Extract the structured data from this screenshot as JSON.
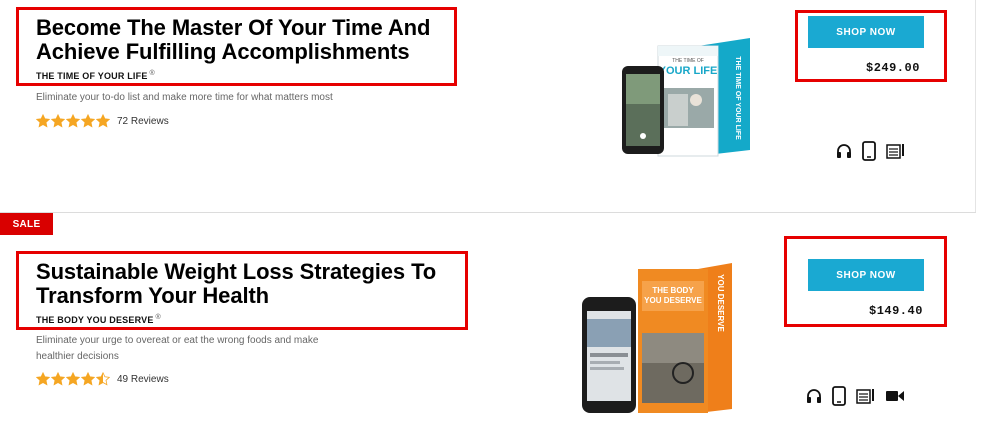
{
  "products": [
    {
      "title": "Become The Master Of Your Time And Achieve Fulfilling Accomplishments",
      "subtitle": "THE TIME OF YOUR LIFE",
      "trademark": "®",
      "description": "Eliminate your to-do list and make more time for what matters most",
      "rating": 5,
      "reviews": "72 Reviews",
      "shop_label": "SHOP NOW",
      "price": "$249.00",
      "box_top_text": "THE TIME OF",
      "box_main_text": "YOUR LIFE",
      "box_side_text": "THE TIME OF YOUR LIFE",
      "formats": [
        "headphones-icon",
        "mobile-icon",
        "workbook-icon"
      ]
    },
    {
      "badge": "SALE",
      "title": "Sustainable Weight Loss Strategies To Transform Your Health",
      "subtitle": "THE BODY YOU DESERVE",
      "trademark": "®",
      "description": "Eliminate your urge to overeat or eat the wrong foods and make healthier decisions",
      "rating": 4.5,
      "reviews": "49 Reviews",
      "shop_label": "SHOP NOW",
      "price": "$149.40",
      "box_main_text": "THE BODY YOU DESERVE",
      "box_side_text": "YOU DESERVE",
      "formats": [
        "headphones-icon",
        "mobile-icon",
        "workbook-icon",
        "video-icon"
      ]
    }
  ],
  "colors": {
    "accent": "#1aa9d2",
    "highlight": "#e60000",
    "star": "#f5a623",
    "sale": "#d90000"
  }
}
